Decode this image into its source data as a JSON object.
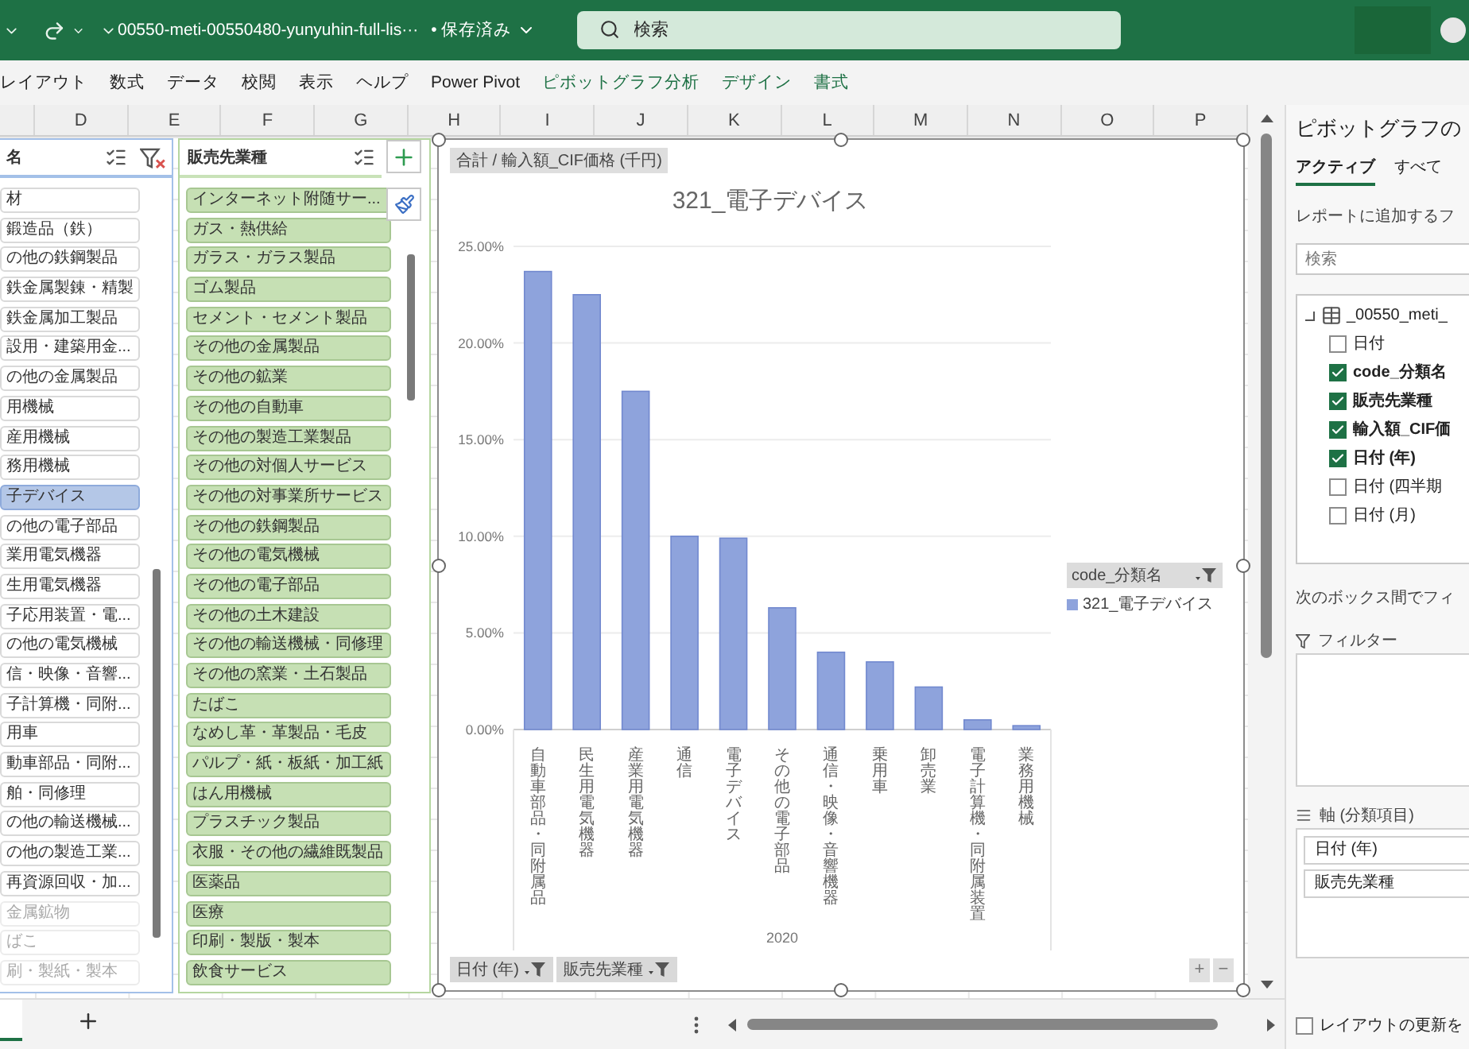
{
  "title_bar": {
    "file_name": "00550-meti-00550480-yunyuhin-full-lis···",
    "save_status": "• 保存済み",
    "search": {
      "placeholder": "検索"
    }
  },
  "ribbon_tabs": [
    {
      "label": "レイアウト",
      "contextual": false
    },
    {
      "label": "数式",
      "contextual": false
    },
    {
      "label": "データ",
      "contextual": false
    },
    {
      "label": "校閲",
      "contextual": false
    },
    {
      "label": "表示",
      "contextual": false
    },
    {
      "label": "ヘルプ",
      "contextual": false
    },
    {
      "label": "Power Pivot",
      "contextual": false
    },
    {
      "label": "ピボットグラフ分析",
      "contextual": true
    },
    {
      "label": "デザイン",
      "contextual": true
    },
    {
      "label": "書式",
      "contextual": true
    }
  ],
  "column_headers": [
    "D",
    "E",
    "F",
    "G",
    "H",
    "I",
    "J",
    "K",
    "L",
    "M",
    "N",
    "O",
    "P"
  ],
  "category_slicer": {
    "header": "名",
    "items": [
      {
        "label": "材",
        "selected": false,
        "available": true
      },
      {
        "label": "鍛造品（鉄）",
        "selected": false,
        "available": true
      },
      {
        "label": "の他の鉄鋼製品",
        "selected": false,
        "available": true
      },
      {
        "label": "鉄金属製錬・精製",
        "selected": false,
        "available": true
      },
      {
        "label": "鉄金属加工製品",
        "selected": false,
        "available": true
      },
      {
        "label": "設用・建築用金...",
        "selected": false,
        "available": true
      },
      {
        "label": "の他の金属製品",
        "selected": false,
        "available": true
      },
      {
        "label": "用機械",
        "selected": false,
        "available": true
      },
      {
        "label": "産用機械",
        "selected": false,
        "available": true
      },
      {
        "label": "務用機械",
        "selected": false,
        "available": true
      },
      {
        "label": "子デバイス",
        "selected": true,
        "available": true
      },
      {
        "label": "の他の電子部品",
        "selected": false,
        "available": true
      },
      {
        "label": "業用電気機器",
        "selected": false,
        "available": true
      },
      {
        "label": "生用電気機器",
        "selected": false,
        "available": true
      },
      {
        "label": "子応用装置・電...",
        "selected": false,
        "available": true
      },
      {
        "label": "の他の電気機械",
        "selected": false,
        "available": true
      },
      {
        "label": "信・映像・音響...",
        "selected": false,
        "available": true
      },
      {
        "label": "子計算機・同附...",
        "selected": false,
        "available": true
      },
      {
        "label": "用車",
        "selected": false,
        "available": true
      },
      {
        "label": "動車部品・同附...",
        "selected": false,
        "available": true
      },
      {
        "label": "舶・同修理",
        "selected": false,
        "available": true
      },
      {
        "label": "の他の輸送機械...",
        "selected": false,
        "available": true
      },
      {
        "label": "の他の製造工業...",
        "selected": false,
        "available": true
      },
      {
        "label": "再資源回収・加...",
        "selected": false,
        "available": true
      },
      {
        "label": "金属鉱物",
        "selected": false,
        "available": false
      },
      {
        "label": "ばこ",
        "selected": false,
        "available": false
      },
      {
        "label": "刷・製紙・製本",
        "selected": false,
        "available": false
      }
    ]
  },
  "industry_slicer": {
    "header": "販売先業種",
    "items": [
      {
        "label": "インターネット附随サー...",
        "selected": true
      },
      {
        "label": "ガス・熱供給",
        "selected": true
      },
      {
        "label": "ガラス・ガラス製品",
        "selected": true
      },
      {
        "label": "ゴム製品",
        "selected": true
      },
      {
        "label": "セメント・セメント製品",
        "selected": true
      },
      {
        "label": "その他の金属製品",
        "selected": true
      },
      {
        "label": "その他の鉱業",
        "selected": true
      },
      {
        "label": "その他の自動車",
        "selected": true
      },
      {
        "label": "その他の製造工業製品",
        "selected": true
      },
      {
        "label": "その他の対個人サービス",
        "selected": true
      },
      {
        "label": "その他の対事業所サービス",
        "selected": true
      },
      {
        "label": "その他の鉄鋼製品",
        "selected": true
      },
      {
        "label": "その他の電気機械",
        "selected": true
      },
      {
        "label": "その他の電子部品",
        "selected": true
      },
      {
        "label": "その他の土木建設",
        "selected": true
      },
      {
        "label": "その他の輸送機械・同修理",
        "selected": true
      },
      {
        "label": "その他の窯業・土石製品",
        "selected": true
      },
      {
        "label": "たばこ",
        "selected": true
      },
      {
        "label": "なめし革・革製品・毛皮",
        "selected": true
      },
      {
        "label": "パルプ・紙・板紙・加工紙",
        "selected": true
      },
      {
        "label": "はん用機械",
        "selected": true
      },
      {
        "label": "プラスチック製品",
        "selected": true
      },
      {
        "label": "衣服・その他の繊維既製品",
        "selected": true
      },
      {
        "label": "医薬品",
        "selected": true
      },
      {
        "label": "医療",
        "selected": true
      },
      {
        "label": "印刷・製版・製本",
        "selected": true
      },
      {
        "label": "飲食サービス",
        "selected": true
      }
    ]
  },
  "chart": {
    "value_button": "合計 / 輸入額_CIF価格 (千円)",
    "legend_title": "code_分類名",
    "axis_buttons": [
      "日付 (年)",
      "販売先業種"
    ],
    "zoom_buttons": [
      "+",
      "−"
    ],
    "chart_data": {
      "type": "bar",
      "title": "321_電子デバイス",
      "xlabel": "2020",
      "categories": [
        "自動車部品・同附属品",
        "民生用電気機器",
        "産業用電気機器",
        "通信",
        "電子デバイス",
        "その他の電子部品",
        "通信・映像・音響機器",
        "乗用車",
        "卸売業",
        "電子計算機・同附属装置",
        "業務用機械"
      ],
      "series": [
        {
          "name": "321_電子デバイス",
          "color": "#8ea3dc",
          "values": [
            23.7,
            22.5,
            17.5,
            10.0,
            9.9,
            6.3,
            4.0,
            3.5,
            2.2,
            0.5,
            0.2
          ]
        }
      ],
      "grid": true,
      "ylim": [
        0,
        25
      ],
      "yticks": [
        {
          "value": 0,
          "label": "0.00%"
        },
        {
          "value": 5,
          "label": "5.00%"
        },
        {
          "value": 10,
          "label": "10.00%"
        },
        {
          "value": 15,
          "label": "15.00%"
        },
        {
          "value": 20,
          "label": "20.00%"
        },
        {
          "value": 25,
          "label": "25.00%"
        }
      ]
    }
  },
  "field_pane": {
    "title": "ピボットグラフの",
    "tabs": [
      {
        "label": "アクティブ",
        "selected": true
      },
      {
        "label": "すべて",
        "selected": false
      }
    ],
    "prompt": "レポートに追加するフ",
    "search": {
      "placeholder": "検索"
    },
    "table": {
      "name": "_00550_meti_",
      "expanded": true,
      "fields": [
        {
          "name": "日付",
          "checked": false
        },
        {
          "name": "code_分類名",
          "checked": true
        },
        {
          "name": "販売先業種",
          "checked": true
        },
        {
          "name": "輸入額_CIF価",
          "checked": true
        },
        {
          "name": "日付 (年)",
          "checked": true
        },
        {
          "name": "日付 (四半期",
          "checked": false
        },
        {
          "name": "日付 (月)",
          "checked": false
        }
      ]
    },
    "hint": "次のボックス間でフィ",
    "filter_label": "フィルター",
    "axis_label": "軸 (分類項目)",
    "axis_items": [
      "日付 (年)",
      "販売先業種"
    ],
    "defer_update": {
      "label": "レイアウトの更新を",
      "checked": false
    }
  }
}
